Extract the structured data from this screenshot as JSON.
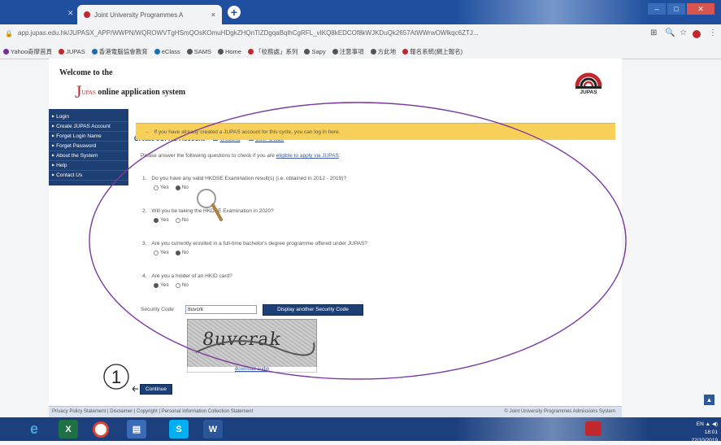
{
  "browser": {
    "tab_title": "Joint University Programmes A",
    "tab_close": "×",
    "new_tab": "+",
    "url": "app.jupas.edu.hk/JUPASX_APP/WWPN/WQROWVTgHSmQOsKOmuHDgkZHQnTlZDgqaBqlhCgRFL_vIKQ8kEDCOf8kWJKDuQk2657AtWWrwOWlkqc6ZTJ...",
    "window_buttons": [
      "–",
      "□",
      "✕"
    ],
    "bookmarks": [
      {
        "label": "Yahoo奇摩首頁",
        "color": "#6b2fa0"
      },
      {
        "label": "JUPAS",
        "color": "#c0282d"
      },
      {
        "label": "香港電腦協會教育",
        "color": "#1d6bb8"
      },
      {
        "label": "eClass",
        "color": "#1d6bb8"
      },
      {
        "label": "SAMS",
        "color": "#555555"
      },
      {
        "label": "Home",
        "color": "#555555"
      },
      {
        "label": "「校務處」系列",
        "color": "#c0282d"
      },
      {
        "label": "Sapy",
        "color": "#555555"
      },
      {
        "label": "注意事項",
        "color": "#555555"
      },
      {
        "label": "方此地",
        "color": "#555555"
      },
      {
        "label": "報名系統(網上報名)",
        "color": "#c0282d"
      }
    ]
  },
  "header": {
    "welcome": "Welcome to the",
    "j_letter": "J",
    "upas_small": "UPAS",
    "system": "online application system",
    "logo_text": "JUPAS"
  },
  "sidebar": {
    "items": [
      {
        "label": "Login"
      },
      {
        "label": "Create JUPAS Account"
      },
      {
        "label": "Forget Login Name"
      },
      {
        "label": "Forget Password"
      },
      {
        "label": "About the System"
      },
      {
        "label": "Help"
      },
      {
        "label": "Contact Us"
      }
    ]
  },
  "content": {
    "title": "Create JUPAS Account",
    "link_website": "Website",
    "link_user_guide": "User Guide",
    "notice": "If you have already created a JUPAS account for this cycle, you can log in here.",
    "intro_prefix": "Please answer the following questions to check if you are ",
    "intro_link": "eligible to apply via JUPAS",
    "intro_suffix": ":",
    "questions": [
      {
        "num": "1.",
        "text": "Do you have any valid HKDSE Examination result(s) (i.e. obtained in 2012 - 2019)?",
        "yes": "Yes",
        "no": "No",
        "selected": "no"
      },
      {
        "num": "2.",
        "text": "Will you be taking the HKDSE Examination in 2020?",
        "yes": "Yes",
        "no": "No",
        "selected": "yes"
      },
      {
        "num": "3.",
        "text": "Are you currently enrolled in a full-time bachelor's degree programme offered under JUPAS?",
        "yes": "Yes",
        "no": "No",
        "selected": "no"
      },
      {
        "num": "4.",
        "text": "Are you a holder of an HKID card?",
        "yes": "Yes",
        "no": "No",
        "selected": "yes"
      }
    ],
    "security_label": "Security Code",
    "security_value": "8uvcrk",
    "another_code_button": "Display another Security Code",
    "captcha_text": "8uvcrak",
    "download_audio": "download audio",
    "continue_button": "Continue"
  },
  "annotation": {
    "step_number": "1"
  },
  "footer": {
    "links": "Privacy Policy Statement | Disclaimer | Copyright | Personal Information Collection Statement",
    "copyright": "© Joint University Programmes Admissions System"
  },
  "taskbar": {
    "time": "18:01",
    "date": "22/10/2019",
    "tray_icons": "EN ▲ ◀)"
  },
  "colors": {
    "nav_bg": "#1d3f73",
    "notice_bg": "#f7d05a",
    "brand_red": "#c0282d",
    "ellipse": "#7a3aa0"
  }
}
